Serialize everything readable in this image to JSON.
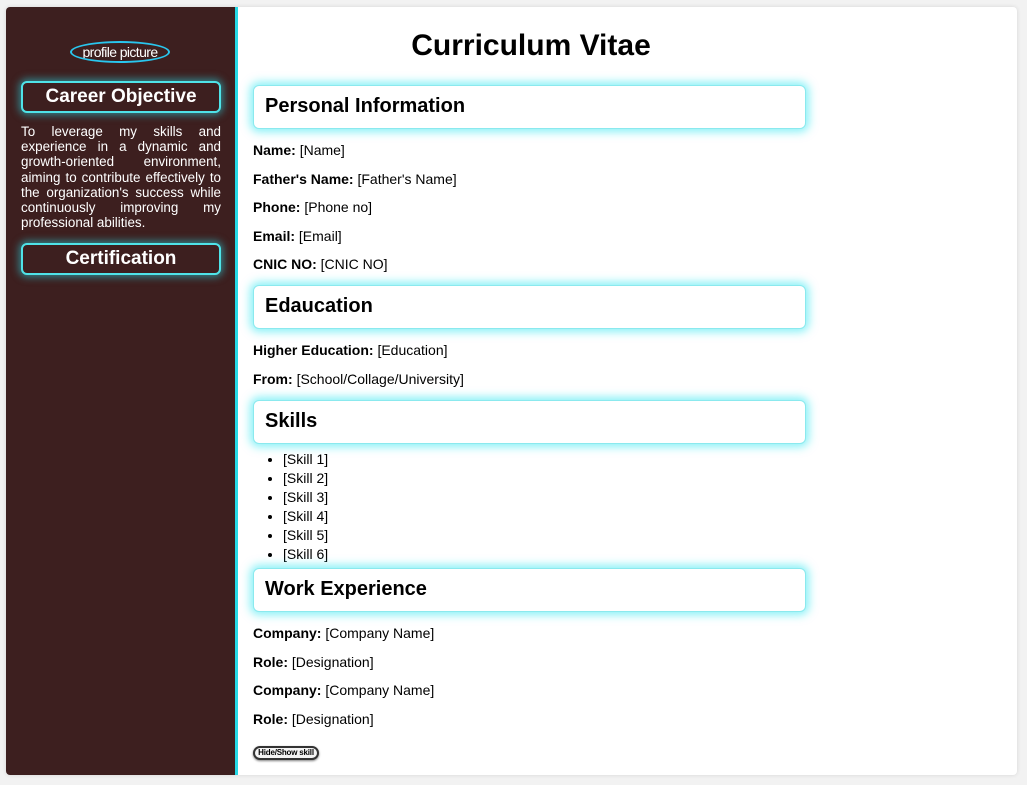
{
  "sidebar": {
    "profile_picture_alt": "profile picture",
    "career_objective_heading": "Career Objective",
    "career_objective_text": "To leverage my skills and experience in a dynamic and growth-oriented environment, aiming to contribute effectively to the organization's success while continuously improving my professional abilities.",
    "certification_heading": "Certification"
  },
  "main": {
    "title": "Curriculum Vitae",
    "personal_info": {
      "heading": "Personal Information",
      "fields": [
        {
          "label": "Name:",
          "value": "[Name]"
        },
        {
          "label": "Father's Name:",
          "value": "[Father's Name]"
        },
        {
          "label": "Phone:",
          "value": "[Phone no]"
        },
        {
          "label": "Email:",
          "value": "[Email]"
        },
        {
          "label": "CNIC NO:",
          "value": "[CNIC NO]"
        }
      ]
    },
    "education": {
      "heading": "Edaucation",
      "fields": [
        {
          "label": "Higher Education:",
          "value": "[Education]"
        },
        {
          "label": "From:",
          "value": "[School/Collage/University]"
        }
      ]
    },
    "skills": {
      "heading": "Skills",
      "items": [
        "[Skill 1]",
        "[Skill 2]",
        "[Skill 3]",
        "[Skill 4]",
        "[Skill 5]",
        "[Skill 6]"
      ]
    },
    "work": {
      "heading": "Work Experience",
      "fields": [
        {
          "label": "Company:",
          "value": "[Company Name]"
        },
        {
          "label": "Role:",
          "value": "[Designation]"
        },
        {
          "label": "Company:",
          "value": "[Company Name]"
        },
        {
          "label": "Role:",
          "value": "[Designation]"
        }
      ]
    },
    "toggle_button_label": "Hide/Show skill"
  },
  "colors": {
    "sidebar_bg": "#3d1f1f",
    "accent_cyan": "#26d9e6",
    "text": "#000000"
  }
}
